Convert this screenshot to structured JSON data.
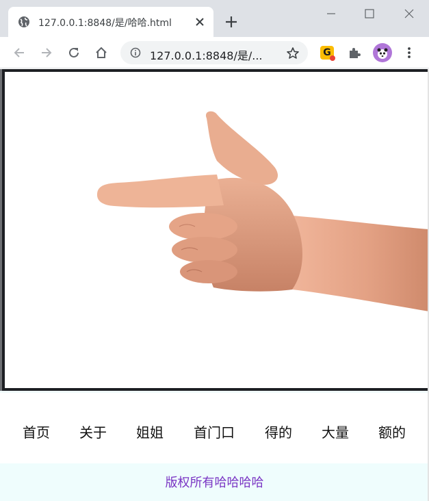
{
  "browser": {
    "tab_title": "127.0.0.1:8848/是/哈哈.html",
    "url": "127.0.0.1:8848/是/...",
    "extension_badge": "G",
    "icons": {
      "favicon": "globe-icon",
      "tab_close": "close-icon",
      "new_tab": "plus-icon",
      "back": "arrow-left-icon",
      "forward": "arrow-right-icon",
      "reload": "reload-icon",
      "home": "home-icon",
      "site_info": "info-icon",
      "bookmark": "star-icon",
      "extensions": "puzzle-icon",
      "menu": "kebab-icon"
    }
  },
  "page": {
    "hero_image": "hand-pointing-image",
    "nav": [
      {
        "label": "首页"
      },
      {
        "label": "关于"
      },
      {
        "label": "姐姐"
      },
      {
        "label": "首门口"
      },
      {
        "label": "得的"
      },
      {
        "label": "大量"
      },
      {
        "label": "额的"
      }
    ],
    "footer_text": "版权所有哈哈哈哈"
  },
  "colors": {
    "footer_background": "#effdfd",
    "footer_text": "#7a35c4",
    "avatar": "#b076d8",
    "extension_badge": "#fbbc04"
  }
}
